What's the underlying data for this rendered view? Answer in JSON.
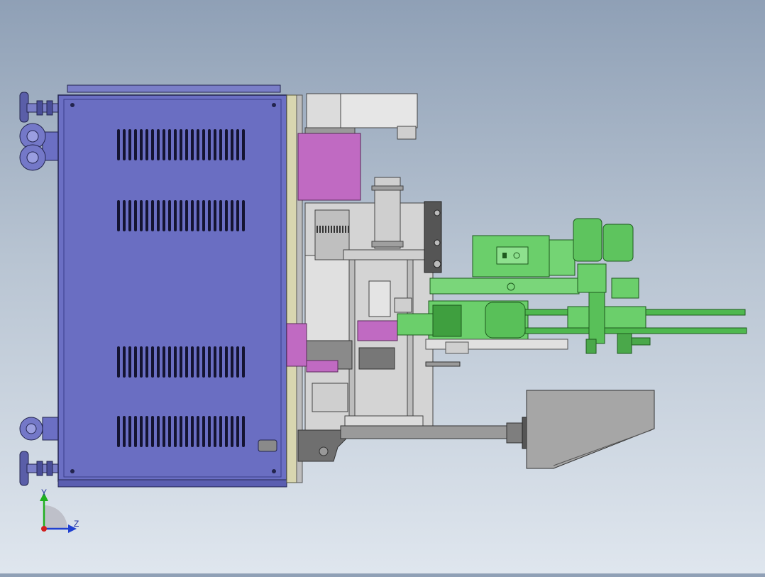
{
  "viewport": {
    "background_top": "#8fa0b6",
    "background_bottom": "#dfe6ee"
  },
  "model_colors": {
    "cabinet": "#6b6fc4",
    "cabinet_edge": "#2a2d6e",
    "magenta_parts": "#c06ac2",
    "steel_parts": "#c8c8c8",
    "green_assembly": "#6bcf6b",
    "hopper": "#a0a0a0"
  },
  "triad": {
    "y_label": "Y",
    "z_label": "Z",
    "y_color": "#20b020",
    "z_color": "#2040d0",
    "x_color": "#d02020"
  }
}
